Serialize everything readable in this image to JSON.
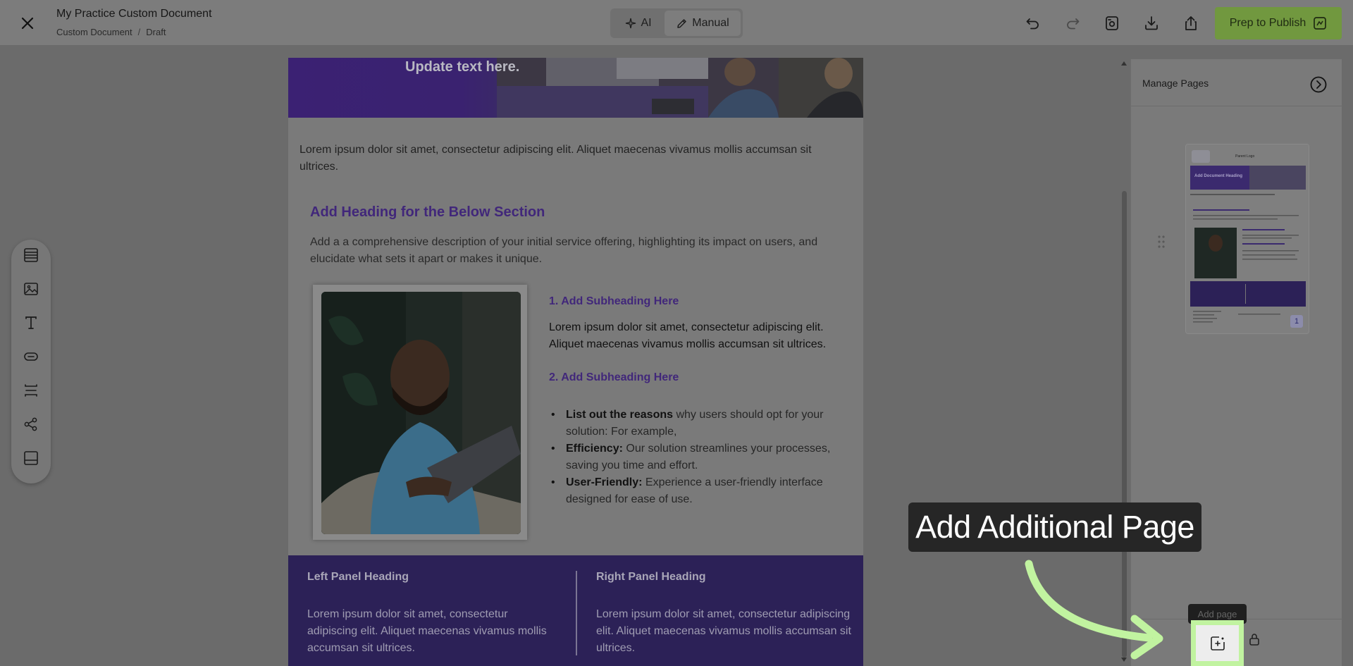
{
  "header": {
    "doc_title": "My Practice Custom Document",
    "crumb_type": "Custom Document",
    "crumb_separator": "/",
    "crumb_status": "Draft",
    "mode_ai": "AI",
    "mode_manual": "Manual",
    "publish_label": "Prep to Publish"
  },
  "document": {
    "hero_text": "Update text here.",
    "intro": "Lorem ipsum dolor sit amet, consectetur adipiscing elit. Aliquet maecenas vivamus mollis accumsan sit ultrices.",
    "section_heading": "Add Heading for the Below Section",
    "section_desc": "Add a a comprehensive description of your initial service offering, highlighting its impact on users, and elucidate what sets it apart or makes it unique.",
    "sub1": "1. Add Subheading Here",
    "body1": "Lorem ipsum dolor sit amet, consectetur adipiscing elit. Aliquet maecenas vivamus mollis accumsan sit ultrices.",
    "sub2": "2. Add Subheading Here",
    "bullets": [
      {
        "bold": "List out the reasons",
        "text": " why users should opt for your solution: For example,"
      },
      {
        "bold": "Efficiency:",
        "text": " Our solution streamlines your processes, saving you time and effort."
      },
      {
        "bold": "User-Friendly:",
        "text": " Experience a user-friendly interface designed for ease of use."
      }
    ],
    "left_panel": {
      "heading": "Left Panel Heading",
      "text": "Lorem ipsum dolor sit amet, consectetur adipiscing elit. Aliquet maecenas vivamus mollis accumsan sit ultrices."
    },
    "right_panel": {
      "heading": "Right Panel Heading",
      "text": "Lorem ipsum dolor sit amet, consectetur adipiscing elit. Aliquet maecenas vivamus mollis accumsan sit ultrices."
    }
  },
  "right_panel": {
    "title": "Manage Pages",
    "page_number": "1",
    "thumb_logo": "Parent Logo",
    "thumb_heading": "Add Document Heading",
    "add_page_tooltip": "Add page"
  },
  "callout": "Add Additional Page",
  "icons": {
    "close": "close-icon",
    "undo": "undo-icon",
    "redo": "redo-icon",
    "preview": "preview-icon",
    "download": "download-icon",
    "share": "share-icon",
    "publish": "publish-icon",
    "left_toolbar": [
      "layout-icon",
      "image-icon",
      "text-icon",
      "button-icon",
      "spacer-icon",
      "social-icon",
      "footer-icon"
    ]
  },
  "colors": {
    "accent_purple": "#41277a",
    "publish_green": "#71983f",
    "highlight_green": "#c1f3a0"
  }
}
